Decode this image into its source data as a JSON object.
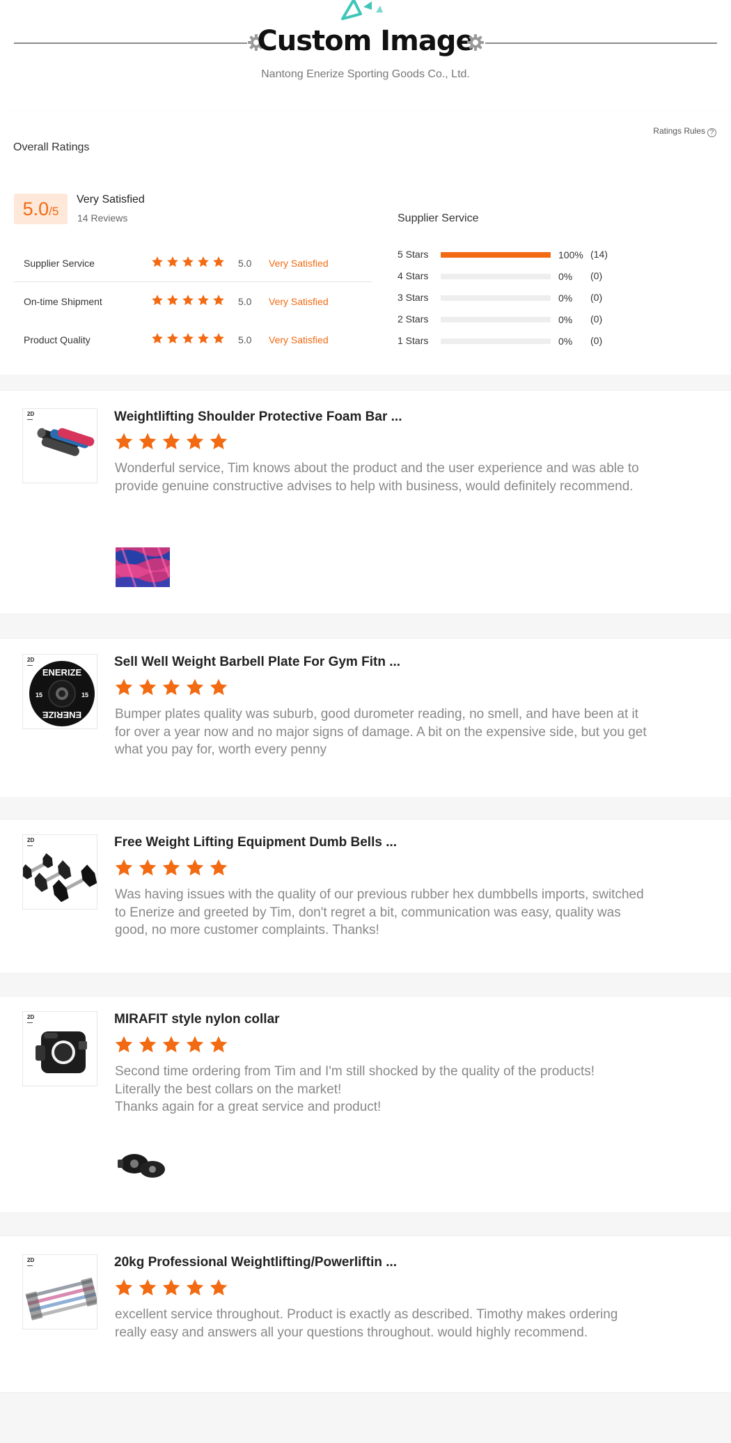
{
  "header": {
    "title": "Custom Image",
    "subtitle": "Nantong Enerize Sporting Goods Co., Ltd.",
    "colors": {
      "accent": "#3ec6b8",
      "line": "#8a8a8a"
    }
  },
  "ratings": {
    "section_title": "Overall Ratings",
    "rules_link": "Ratings Rules",
    "help_icon": "?",
    "score": "5.0",
    "score_suffix": "/5",
    "score_label": "Very Satisfied",
    "review_count": "14 Reviews",
    "categories": [
      {
        "name": "Supplier Service",
        "stars": 5,
        "score": "5.0",
        "label": "Very Satisfied"
      },
      {
        "name": "On-time Shipment",
        "stars": 5,
        "score": "5.0",
        "label": "Very Satisfied"
      },
      {
        "name": "Product Quality",
        "stars": 5,
        "score": "5.0",
        "label": "Very Satisfied"
      }
    ],
    "distribution_title": "Supplier Service",
    "distribution": [
      {
        "label": "5 Stars",
        "percent": "100%",
        "fraction": 1.0,
        "count": "(14)"
      },
      {
        "label": "4 Stars",
        "percent": "0%",
        "fraction": 0,
        "count": "(0)"
      },
      {
        "label": "3 Stars",
        "percent": "0%",
        "fraction": 0,
        "count": "(0)"
      },
      {
        "label": "2 Stars",
        "percent": "0%",
        "fraction": 0,
        "count": "(0)"
      },
      {
        "label": "1 Stars",
        "percent": "0%",
        "fraction": 0,
        "count": "(0)"
      }
    ],
    "colors": {
      "star": "#f26a12",
      "badge_bg": "#fde8d9",
      "bar_track": "#eeeeee"
    }
  },
  "reviews": [
    {
      "title": "Weightlifting Shoulder Protective Foam Bar ...",
      "stars": 5,
      "text": "Wonderful service, Tim knows about the product and the user experience and was able to provide genuine constructive advises to help with business, would definitely recommend.",
      "thumb_icon": "foam-bar-pads-image",
      "photo_icon": "foam-pads-closeup-image"
    },
    {
      "title": "Sell Well Weight Barbell Plate For Gym Fitn ...",
      "stars": 5,
      "text": "Bumper plates quality was suburb, good durometer reading, no smell, and have been at it for over a year now and no major signs of damage. A bit on the expensive side, but you get what you pay for, worth every penny",
      "thumb_icon": "bumper-plate-image",
      "plate_text": "ENERIZE",
      "plate_weight": "15",
      "photo_icon": ""
    },
    {
      "title": "Free Weight Lifting Equipment Dumb Bells ...",
      "stars": 5,
      "text": "Was having issues with the quality of our previous rubber hex dumbbells imports, switched to Enerize and greeted by Tim, don't regret a bit, communication was easy, quality was good, no more customer complaints. Thanks!",
      "thumb_icon": "hex-dumbbells-image",
      "photo_icon": ""
    },
    {
      "title": "MIRAFIT style nylon collar",
      "stars": 5,
      "text": "Second time ordering from Tim and I'm still shocked by the quality of the products!\nLiterally the best collars on the market!\nThanks again for a great service and product!",
      "thumb_icon": "barbell-collar-image",
      "photo_icon": "collars-photo-image"
    },
    {
      "title": "20kg Professional Weightlifting/Powerliftin ...",
      "stars": 5,
      "text": "excellent service throughout. Product is exactly as described. Timothy makes ordering really easy and answers all your questions throughout. would highly recommend.",
      "thumb_icon": "barbell-bars-image",
      "photo_icon": ""
    }
  ]
}
